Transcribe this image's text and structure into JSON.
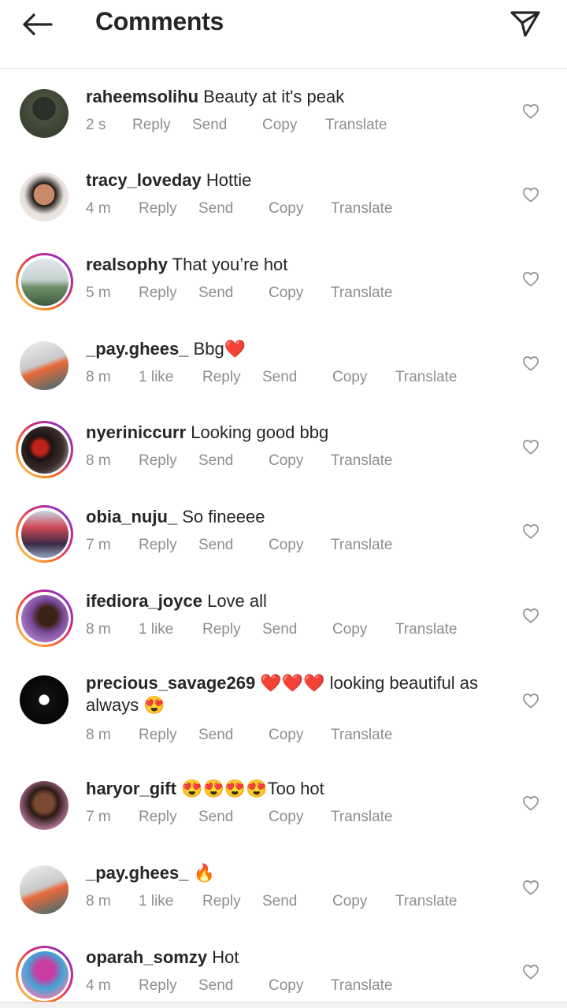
{
  "header": {
    "title": "Comments",
    "back_icon": "arrow-left-icon",
    "share_icon": "paper-plane-icon"
  },
  "actions": {
    "reply": "Reply",
    "send": "Send",
    "copy": "Copy",
    "translate": "Translate"
  },
  "comments": [
    {
      "username": "raheemsolihu",
      "text": "Beauty at it's peak",
      "time": "2 s",
      "likes": "",
      "story_ring": false
    },
    {
      "username": "tracy_loveday",
      "text": "Hottie",
      "time": "4 m",
      "likes": "",
      "story_ring": false
    },
    {
      "username": "realsophy",
      "text": "That you’re hot",
      "time": "5 m",
      "likes": "",
      "story_ring": true
    },
    {
      "username": "_pay.ghees_",
      "text": "Bbg❤️",
      "time": "8 m",
      "likes": "1 like",
      "story_ring": false
    },
    {
      "username": "nyeriniccurr",
      "text": "Looking good bbg",
      "time": "8 m",
      "likes": "",
      "story_ring": true
    },
    {
      "username": "obia_nuju_",
      "text": "So fineeee",
      "time": "7 m",
      "likes": "",
      "story_ring": true
    },
    {
      "username": "ifediora_joyce",
      "text": "Love all",
      "time": "8 m",
      "likes": "1 like",
      "story_ring": true
    },
    {
      "username": "precious_savage269",
      "text": "❤️❤️❤️ looking beautiful as always 😍",
      "time": "8 m",
      "likes": "",
      "story_ring": false
    },
    {
      "username": "haryor_gift",
      "text": "😍😍😍😍Too hot",
      "time": "7 m",
      "likes": "",
      "story_ring": false
    },
    {
      "username": "_pay.ghees_",
      "text": "🔥",
      "time": "8 m",
      "likes": "1 like",
      "story_ring": false
    },
    {
      "username": "oparah_somzy",
      "text": "Hot",
      "time": "4 m",
      "likes": "",
      "story_ring": true
    }
  ]
}
